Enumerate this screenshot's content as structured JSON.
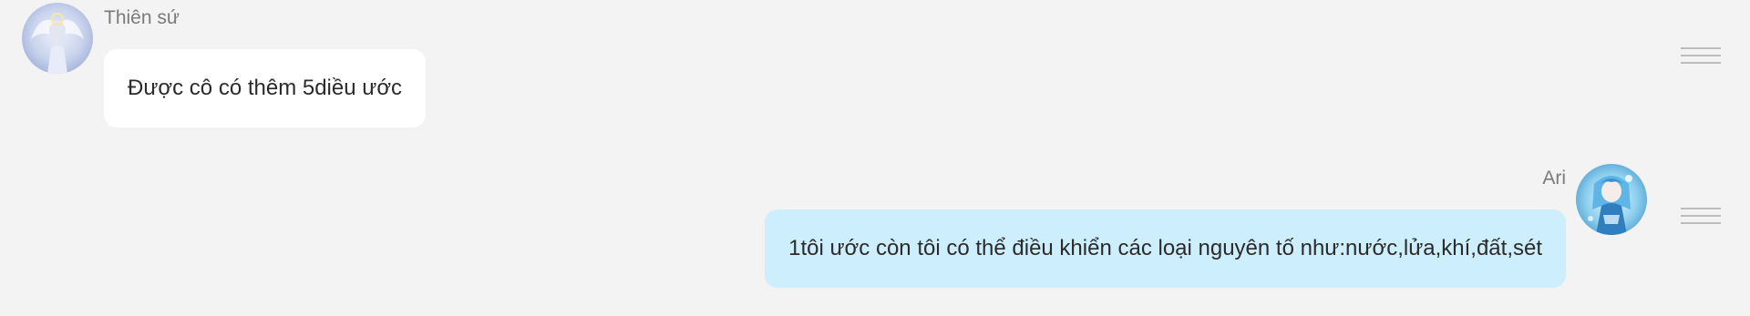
{
  "messages": [
    {
      "sender": "Thiên sứ",
      "text": "Được cô có thêm 5diều ước",
      "side": "left",
      "avatar_icon": "angel-avatar-icon"
    },
    {
      "sender": "Ari",
      "text": "1tôi ước còn tôi có thể điều khiển các loại nguyên tố như:nước,lửa,khí,đất,sét",
      "side": "right",
      "avatar_icon": "anime-girl-avatar-icon"
    }
  ],
  "colors": {
    "background": "#f3f3f3",
    "left_bubble": "#ffffff",
    "right_bubble": "#cdeefc",
    "name_text": "#7a7a7a",
    "message_text": "#2b2b2b",
    "menu_handle": "#bdbdbd"
  }
}
